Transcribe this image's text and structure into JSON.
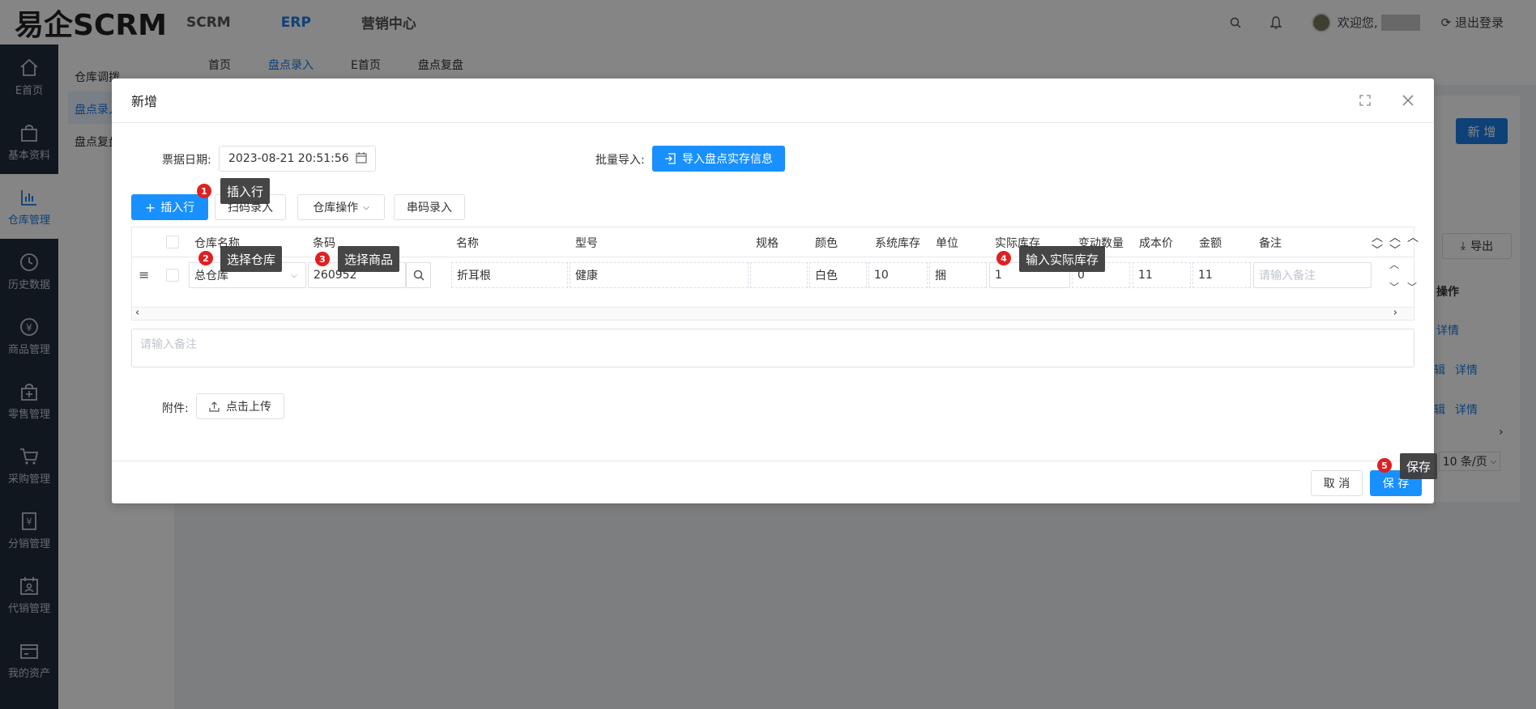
{
  "header": {
    "logo": "易企SCRM",
    "nav": [
      "SCRM",
      "ERP",
      "营销中心"
    ],
    "welcome": "欢迎您,",
    "logout": "退出登录"
  },
  "sidebar": {
    "items": [
      {
        "label": "E首页",
        "icon": "home-icon"
      },
      {
        "label": "基本资料",
        "icon": "bag-icon"
      },
      {
        "label": "仓库管理",
        "icon": "bar-chart-icon"
      },
      {
        "label": "历史数据",
        "icon": "clock-icon"
      },
      {
        "label": "商品管理",
        "icon": "yen-icon"
      },
      {
        "label": "零售管理",
        "icon": "bag-plus-icon"
      },
      {
        "label": "采购管理",
        "icon": "cart-icon"
      },
      {
        "label": "分销管理",
        "icon": "yen-doc-icon"
      },
      {
        "label": "代销管理",
        "icon": "calendar-user-icon"
      },
      {
        "label": "我的资产",
        "icon": "wallet-icon"
      }
    ]
  },
  "submenu": {
    "items": [
      "仓库调拨",
      "盘点录入",
      "盘点复盘"
    ]
  },
  "tabs": [
    "首页",
    "盘点录入",
    "E首页",
    "盘点复盘"
  ],
  "background": {
    "new_button": "新 增",
    "export_button": "导出",
    "ops_header": "操作",
    "detail_link": "详情",
    "edit_fragment": "辑",
    "page_size": "10 条/页"
  },
  "dialog": {
    "title": "新增",
    "date_label": "票据日期:",
    "date_value": "2023-08-21 20:51:56",
    "batch_label": "批量导入:",
    "import_button": "导入盘点实存信息",
    "insert_row": "插入行",
    "scan_entry": "扫码录入",
    "warehouse_ops": "仓库操作",
    "serial_entry": "串码录入",
    "columns": [
      "仓库名称",
      "条码",
      "名称",
      "型号",
      "规格",
      "颜色",
      "系统库存",
      "单位",
      "实际库存",
      "变动数量",
      "成本价",
      "金额",
      "备注"
    ],
    "row": {
      "warehouse": "总仓库",
      "barcode": "260952",
      "name": "折耳根",
      "model": "健康",
      "spec": "",
      "color": "白色",
      "system_stock": "10",
      "unit": "捆",
      "actual_stock": "1",
      "change_qty": "0",
      "cost": "11",
      "amount": "11",
      "remark_placeholder": "请输入备注"
    },
    "remark_placeholder": "请输入备注",
    "attachment_label": "附件:",
    "upload_button": "点击上传",
    "cancel_button": "取 消",
    "save_button": "保 存"
  },
  "tooltips": [
    {
      "num": "1",
      "text": "插入行"
    },
    {
      "num": "2",
      "text": "选择仓库"
    },
    {
      "num": "3",
      "text": "选择商品"
    },
    {
      "num": "4",
      "text": "输入实际库存"
    },
    {
      "num": "5",
      "text": "保存"
    }
  ],
  "colors": {
    "primary": "#1890ff",
    "sidebar_bg": "#1f2d3d",
    "badge": "#e02020"
  }
}
